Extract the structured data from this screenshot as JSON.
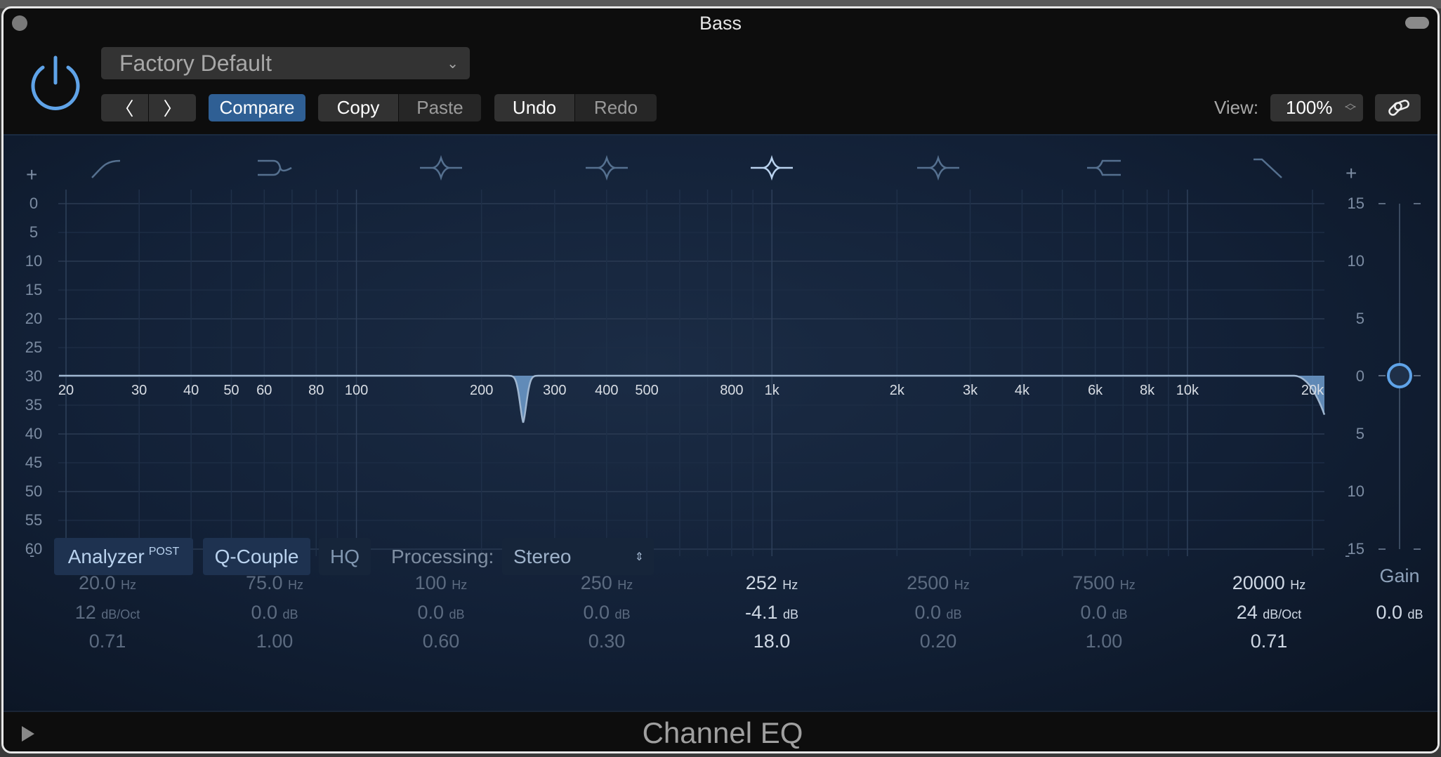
{
  "window": {
    "title": "Bass",
    "plugin_name": "Channel EQ"
  },
  "header": {
    "preset": "Factory Default",
    "compare": "Compare",
    "copy": "Copy",
    "paste": "Paste",
    "undo": "Undo",
    "redo": "Redo",
    "view_label": "View:",
    "view_value": "100%"
  },
  "graph": {
    "left_scale": [
      "0",
      "5",
      "10",
      "15",
      "20",
      "25",
      "30",
      "35",
      "40",
      "45",
      "50",
      "55",
      "60"
    ],
    "right_scale": [
      "15",
      "10",
      "5",
      "0",
      "5",
      "10",
      "15"
    ],
    "freq_labels": [
      [
        "20",
        20
      ],
      [
        "30",
        30
      ],
      [
        "40",
        40
      ],
      [
        "50",
        50
      ],
      [
        "60",
        60
      ],
      [
        "80",
        80
      ],
      [
        "100",
        100
      ],
      [
        "200",
        200
      ],
      [
        "300",
        300
      ],
      [
        "400",
        400
      ],
      [
        "500",
        500
      ],
      [
        "800",
        800
      ],
      [
        "1k",
        1000
      ],
      [
        "2k",
        2000
      ],
      [
        "3k",
        3000
      ],
      [
        "4k",
        4000
      ],
      [
        "6k",
        6000
      ],
      [
        "8k",
        8000
      ],
      [
        "10k",
        10000
      ],
      [
        "20k",
        20000
      ]
    ],
    "plus": "+",
    "minus": "-"
  },
  "bands": [
    {
      "type": "low-cut",
      "freq": "20.0",
      "freq_unit": "Hz",
      "gain": "12",
      "gain_unit": "dB/Oct",
      "q": "0.71",
      "active": false
    },
    {
      "type": "low-shelf",
      "freq": "75.0",
      "freq_unit": "Hz",
      "gain": "0.0",
      "gain_unit": "dB",
      "q": "1.00",
      "active": false
    },
    {
      "type": "bell",
      "freq": "100",
      "freq_unit": "Hz",
      "gain": "0.0",
      "gain_unit": "dB",
      "q": "0.60",
      "active": false
    },
    {
      "type": "bell",
      "freq": "250",
      "freq_unit": "Hz",
      "gain": "0.0",
      "gain_unit": "dB",
      "q": "0.30",
      "active": false
    },
    {
      "type": "bell",
      "freq": "252",
      "freq_unit": "Hz",
      "gain": "-4.1",
      "gain_unit": "dB",
      "q": "18.0",
      "active": true
    },
    {
      "type": "bell",
      "freq": "2500",
      "freq_unit": "Hz",
      "gain": "0.0",
      "gain_unit": "dB",
      "q": "0.20",
      "active": false
    },
    {
      "type": "high-shelf",
      "freq": "7500",
      "freq_unit": "Hz",
      "gain": "0.0",
      "gain_unit": "dB",
      "q": "1.00",
      "active": false
    },
    {
      "type": "high-cut",
      "freq": "20000",
      "freq_unit": "Hz",
      "gain": "24",
      "gain_unit": "dB/Oct",
      "q": "0.71",
      "active": true
    }
  ],
  "gain": {
    "label": "Gain",
    "value": "0.0",
    "unit": "dB",
    "level_db": 0
  },
  "bottom": {
    "analyzer": "Analyzer",
    "analyzer_mode": "POST",
    "q_couple": "Q-Couple",
    "hq": "HQ",
    "processing_label": "Processing:",
    "processing_value": "Stereo"
  },
  "colors": {
    "accent": "#5fa3e8",
    "compare": "#2f5f94",
    "curve": "#6f9ccc"
  }
}
